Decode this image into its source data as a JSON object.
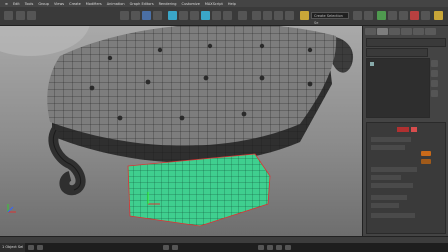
{
  "menu": {
    "items": [
      "≡",
      "Edit",
      "Tools",
      "Group",
      "Views",
      "Create",
      "Modifiers",
      "Animation",
      "Graph Editors",
      "Rendering",
      "Customize",
      "MAXScript",
      "Help"
    ]
  },
  "toolbar": {
    "selection_set_value": "Create Selection Se"
  },
  "viewport": {
    "label": "",
    "accent": "#3fcf8f",
    "model": "tufted-ottoman-mesh"
  },
  "command_panel": {
    "accent_red": "#b03030",
    "accent_orange": "#c86a1a",
    "accent_green": "#3fcf8f"
  },
  "statusbar": {
    "left_text": "1 Object Sel"
  },
  "icons": [
    "app-icon",
    "undo-icon",
    "redo-icon",
    "link-icon",
    "select-icon",
    "move-icon",
    "rotate-icon",
    "scale-icon",
    "snap-icon",
    "render-icon",
    "axis-gizmo-icon"
  ]
}
